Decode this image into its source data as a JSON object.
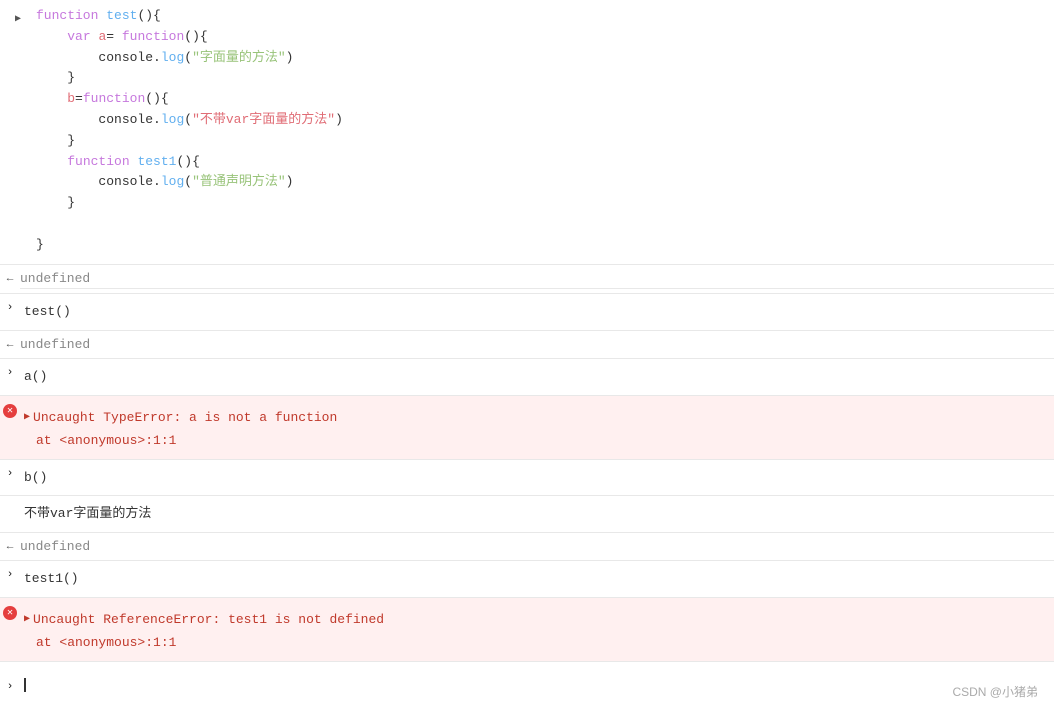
{
  "console": {
    "code_block": {
      "lines": [
        {
          "indent": 0,
          "content": "function test(){",
          "type": "mixed"
        },
        {
          "indent": 1,
          "content": "    var a= function(){",
          "type": "mixed"
        },
        {
          "indent": 2,
          "content": "        console.log(\"字面量的方法\")",
          "type": "mixed"
        },
        {
          "indent": 1,
          "content": "    }",
          "type": "plain"
        },
        {
          "indent": 1,
          "content": "    b=function(){",
          "type": "mixed"
        },
        {
          "indent": 2,
          "content": "        console.log(\"不带var字面量的方法\")",
          "type": "mixed"
        },
        {
          "indent": 1,
          "content": "    }",
          "type": "plain"
        },
        {
          "indent": 1,
          "content": "    function test1(){",
          "type": "mixed"
        },
        {
          "indent": 2,
          "content": "        console.log(\"普通声明方法\")",
          "type": "mixed"
        },
        {
          "indent": 1,
          "content": "    }",
          "type": "plain"
        },
        {
          "indent": 0,
          "content": "",
          "type": "plain"
        },
        {
          "indent": 0,
          "content": "}",
          "type": "plain"
        }
      ]
    },
    "rows": [
      {
        "type": "output",
        "prefix": "←",
        "text": "undefined"
      },
      {
        "type": "input",
        "prefix": ">",
        "text": "test()"
      },
      {
        "type": "output",
        "prefix": "←",
        "text": "undefined"
      },
      {
        "type": "input",
        "prefix": ">",
        "text": "a()"
      },
      {
        "type": "error",
        "icon": "×",
        "lines": [
          "▶ Uncaught TypeError: a is not a function",
          "    at <anonymous>:1:1"
        ]
      },
      {
        "type": "input",
        "prefix": ">",
        "text": "b()"
      },
      {
        "type": "print",
        "text": "不带var字面量的方法"
      },
      {
        "type": "output",
        "prefix": "←",
        "text": "undefined"
      },
      {
        "type": "input",
        "prefix": ">",
        "text": "test1()"
      },
      {
        "type": "error",
        "icon": "×",
        "lines": [
          "▶ Uncaught ReferenceError: test1 is not defined",
          "    at <anonymous>:1:1"
        ]
      }
    ],
    "watermark": "CSDN @小猪弟"
  }
}
